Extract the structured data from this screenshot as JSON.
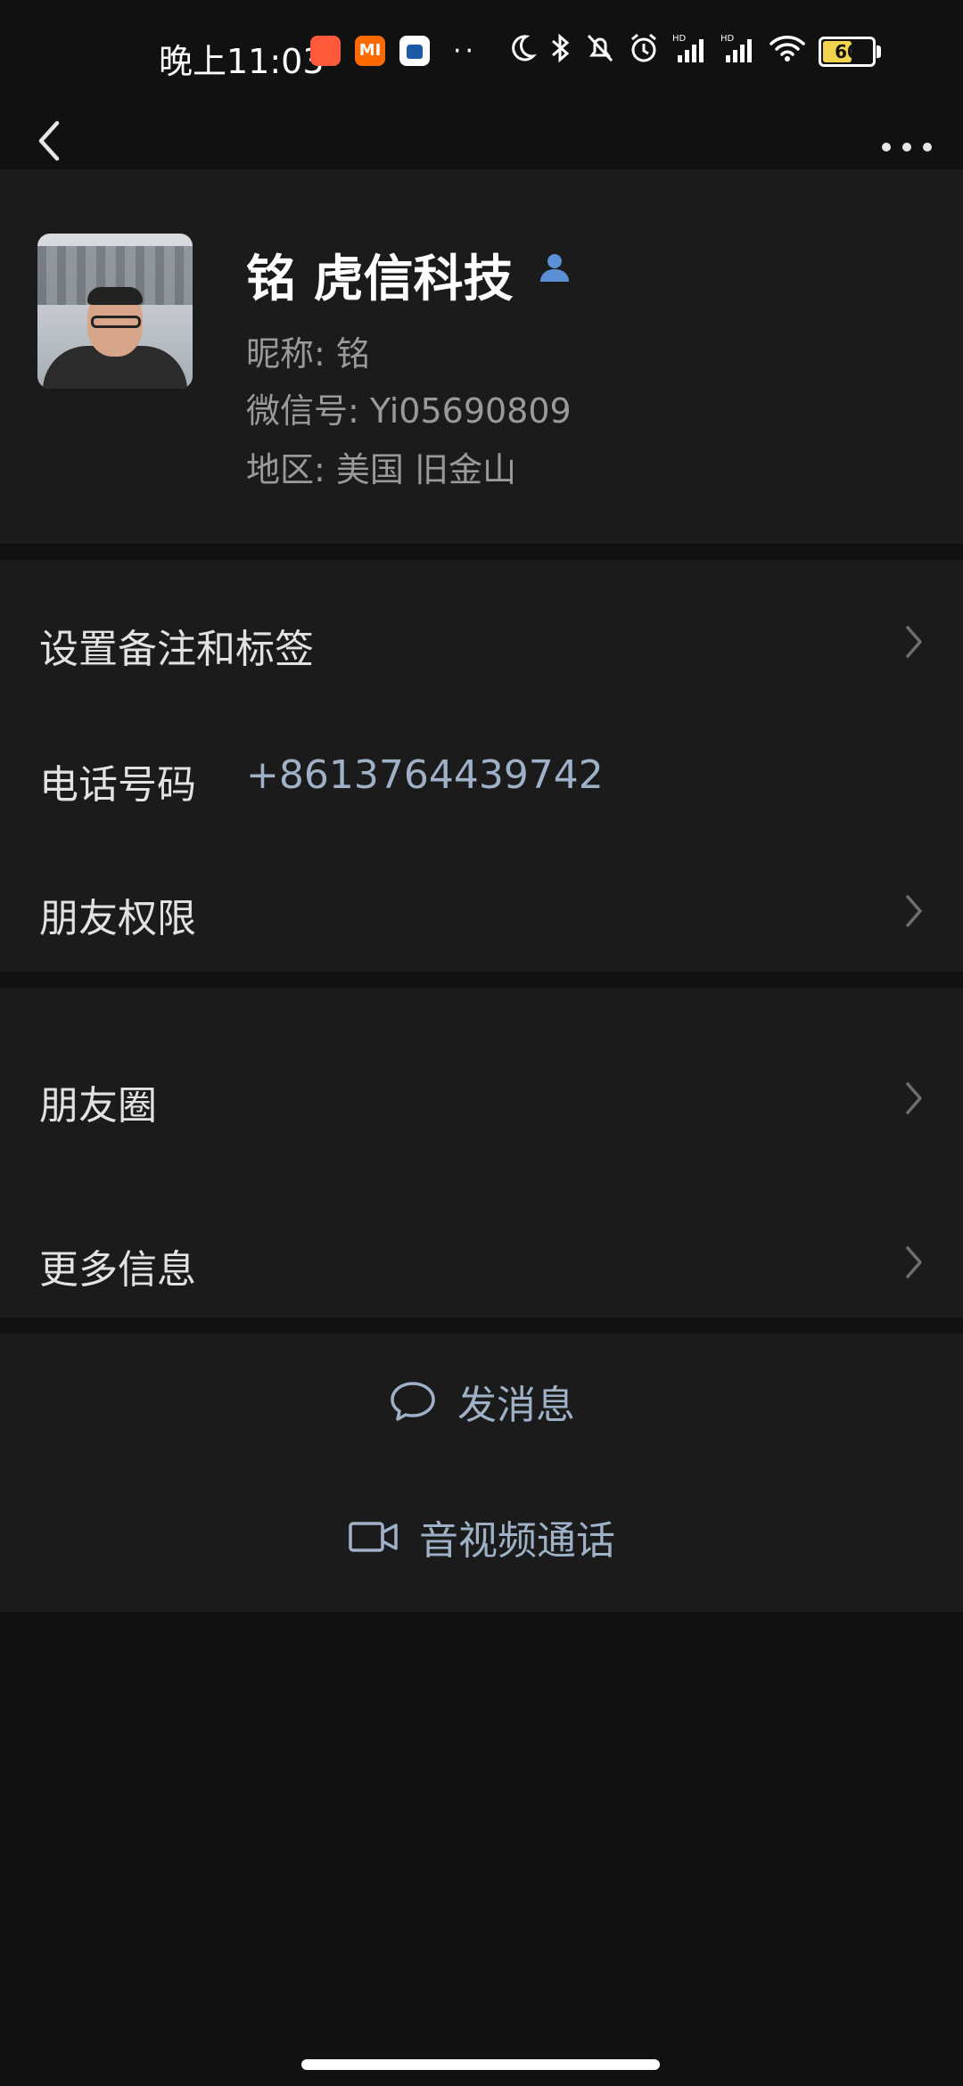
{
  "status_bar": {
    "time": "晚上11:03",
    "battery": "60",
    "battery_level": 0.6,
    "icons": [
      "app-icon-red",
      "mi-icon",
      "app-icon-blue",
      "more-dots",
      "moon-icon",
      "bluetooth-icon",
      "bell-off-icon",
      "alarm-icon",
      "signal-hd-icon",
      "signal-hd-icon",
      "wifi-icon",
      "battery-icon"
    ],
    "mi_label": "MI",
    "dots": "··"
  },
  "topbar": {
    "back_icon": "chevron-left-icon",
    "more_icon": "more-horizontal-icon"
  },
  "profile": {
    "name": "铭 虎信科技",
    "nickname": "昵称: 铭",
    "wechat_id": "微信号: Yi05690809",
    "region": "地区: 美国  旧金山"
  },
  "rows": {
    "remark_tags": "设置备注和标签",
    "phone_label": "电话号码",
    "phone_value": "+8613764439742",
    "friend_permissions": "朋友权限",
    "moments": "朋友圈",
    "more_info": "更多信息"
  },
  "actions": {
    "send_message": "发消息",
    "av_call": "音视频通话"
  },
  "colors": {
    "background": "#111111",
    "card": "#1b1b1b",
    "link": "#9fb1c6",
    "accent_person": "#5b8fd6"
  }
}
